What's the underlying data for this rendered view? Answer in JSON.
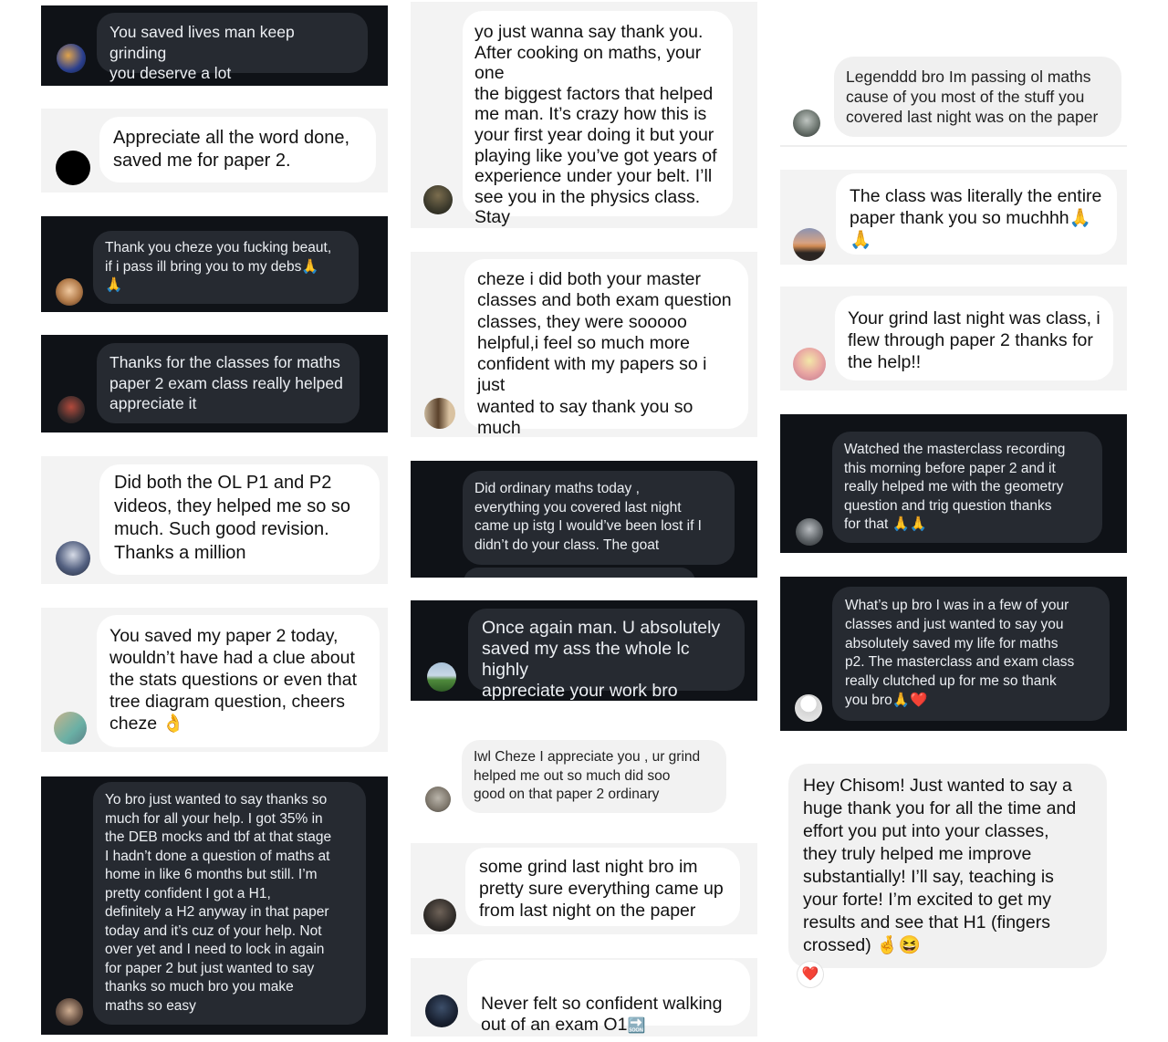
{
  "messages": {
    "m1": {
      "text": "You saved lives man keep grinding\nyou deserve a lot"
    },
    "m2": {
      "text": "Appreciate all the word done,\nsaved me for paper 2."
    },
    "m3": {
      "text": "Thank you cheze you fucking beaut,\nif i pass ill bring you to my debs🙏\n🙏"
    },
    "m4": {
      "text": "Thanks for the classes for maths\npaper 2 exam class really helped\nappreciate it"
    },
    "m5": {
      "text": "Did both the OL P1 and P2\nvideos, they helped me so so\nmuch. Such good revision.\nThanks a million"
    },
    "m6": {
      "text": "You saved my paper 2 today,\nwouldn’t have had a clue about\nthe stats questions or even that\ntree diagram question, cheers\ncheze 👌"
    },
    "m7": {
      "text": "Yo bro just wanted to say thanks so\nmuch for all your help. I got 35% in\nthe DEB mocks and tbf at that stage\nI hadn’t done a question of maths at\nhome in like 6 months but still. I’m\npretty confident I got a H1,\ndefinitely a H2 anyway in that paper\ntoday and it’s cuz of your help. Not\nover yet and I need to lock in again\nfor paper 2 but just wanted to say\nthanks so much bro you make\nmaths so easy"
    },
    "m8": {
      "text": "yo just wanna say thank you.\nAfter cooking on maths, your one\nthe biggest factors that helped\nme man. It’s crazy how this is\nyour first year doing it but your\nplaying like you’ve got years of\nexperience under your belt. I’ll\nsee you in the physics class. Stay\nblessed chizzo"
    },
    "m9": {
      "text": "cheze i did both your master\nclasses and both exam question\nclasses, they were sooooo\nhelpful,i feel so much more\nconfident with my papers so i just\nwanted to say thank you so much\nGod bless 🙏🙏"
    },
    "m10": {
      "text": "Did ordinary maths today ,\neverything you covered last night\ncame up istg I would’ve been lost if I\ndidn’t do your class. The goat"
    },
    "m11": {
      "text": "Once again man. U absolutely\nsaved my ass the whole lc highly\nappreciate your work bro"
    },
    "m12": {
      "text": "Iwl Cheze I appreciate you , ur grind\nhelped me out so much did soo\ngood on that paper 2 ordinary"
    },
    "m13": {
      "text": "some grind last night bro im\npretty sure everything came up\nfrom last night on the paper"
    },
    "m14": {
      "text": "Never felt so confident walking\nout of an exam O1",
      "emoji": "🔜"
    },
    "m15": {
      "text": "Legenddd bro Im passing ol maths\ncause of you most of the stuff you\ncovered last night was on the paper"
    },
    "m16": {
      "text": "The class was literally the entire\npaper thank you so muchhh🙏\n🙏"
    },
    "m17": {
      "text": "Your grind last night was class, i\nflew through paper 2 thanks for\nthe help!!"
    },
    "m18": {
      "text": "Watched the masterclass recording\nthis morning before paper 2 and it\nreally helped me with the geometry\nquestion and trig question thanks\nfor that 🙏🙏"
    },
    "m19": {
      "text": "What’s up bro I was in a few of your\nclasses and just wanted to say you\nabsolutely saved my life for maths\np2. The masterclass and exam class\nreally clutched up for me so thank\nyou bro🙏❤️"
    },
    "m20": {
      "text": "Hey Chisom! Just wanted to say a\nhuge thank you for all the time and\neffort you put into your classes,\nthey truly helped me improve\nsubstantially! I’ll say, teaching is\nyour forte! I’m excited to get my\nresults and see that H1 (fingers\ncrossed) 🤞😆",
      "reaction": "❤️"
    }
  },
  "colors": {
    "dark_bg": "#0f1217",
    "dark_bubble": "#262a31",
    "light_bg": "#f3f3f3",
    "light_bubble": "#ffffff"
  }
}
